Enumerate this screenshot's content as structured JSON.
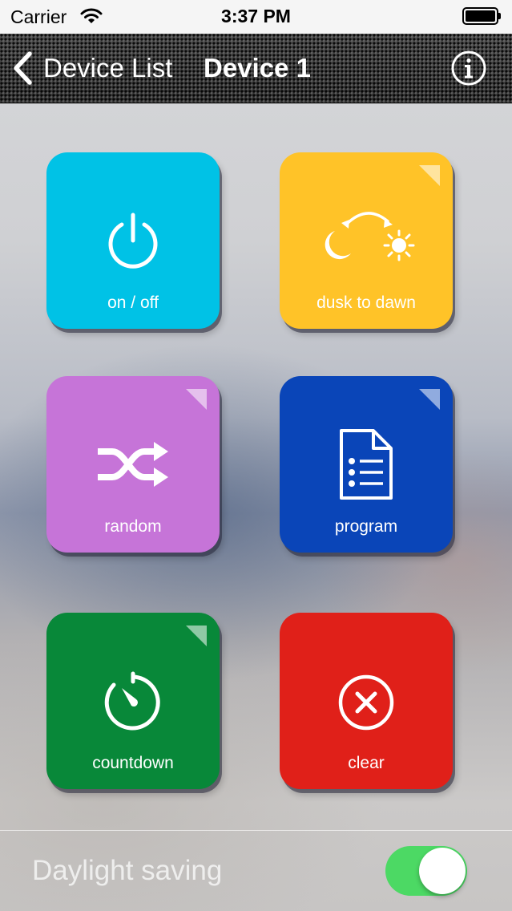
{
  "status_bar": {
    "carrier": "Carrier",
    "time": "3:37 PM",
    "wifi_icon": "wifi-icon",
    "battery_icon": "battery-icon"
  },
  "nav": {
    "back_label": "Device List",
    "title": "Device 1",
    "back_icon": "chevron-left-icon",
    "info_icon": "info-circle-icon"
  },
  "tiles": [
    {
      "label": "on / off",
      "icon": "power-icon",
      "color": "#00c2e6",
      "has_corner": false
    },
    {
      "label": "dusk to dawn",
      "icon": "moon-sun-icon",
      "color": "#ffc328",
      "has_corner": true
    },
    {
      "label": "random",
      "icon": "shuffle-icon",
      "color": "#c674d8",
      "has_corner": true
    },
    {
      "label": "program",
      "icon": "document-list-icon",
      "color": "#0a45b8",
      "has_corner": true
    },
    {
      "label": "countdown",
      "icon": "timer-icon",
      "color": "#088839",
      "has_corner": true
    },
    {
      "label": "clear",
      "icon": "close-circle-icon",
      "color": "#e02019",
      "has_corner": false
    }
  ],
  "daylight_saving": {
    "label": "Daylight saving",
    "enabled": true,
    "toggle_color": "#4cd964"
  }
}
